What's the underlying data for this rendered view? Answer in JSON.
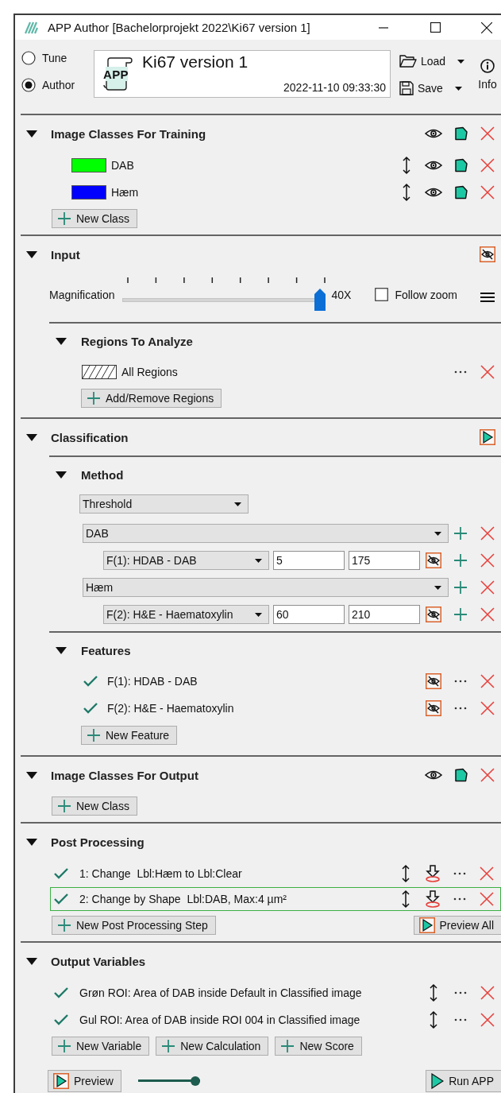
{
  "window": {
    "title": "APP Author [Bachelorprojekt 2022\\Ki67 version 1]"
  },
  "modes": [
    {
      "label": "Tune",
      "selected": false
    },
    {
      "label": "Author",
      "selected": true
    }
  ],
  "app": {
    "logo_text": "APP",
    "name": "Ki67 version 1",
    "timestamp": "2022-11-10 09:33:30"
  },
  "file_menu": [
    {
      "kind": "load",
      "label": "Load"
    },
    {
      "kind": "save",
      "label": "Save"
    }
  ],
  "info": {
    "label": "Info"
  },
  "sections": [
    {
      "kind": "classes",
      "title": "Image Classes For Training",
      "expanded": true,
      "classes": [
        {
          "name": "DAB",
          "color": "#00ff00"
        },
        {
          "name": "Hæm",
          "color": "#0000ff"
        }
      ],
      "buttons": [
        "New Class"
      ]
    },
    {
      "kind": "input",
      "title": "Input",
      "expanded": true,
      "magnification": {
        "label": "Magnification",
        "level": 1,
        "reading": "40X"
      },
      "follow_zoom": {
        "label": "Follow zoom",
        "checked": false
      },
      "subsections": [
        {
          "kind": "regions",
          "title": "Regions To Analyze",
          "expanded": true,
          "regions": [
            {
              "name": "All Regions"
            }
          ],
          "buttons": [
            "Add/Remove Regions"
          ]
        }
      ]
    },
    {
      "kind": "classification",
      "title": "Classification",
      "expanded": true,
      "subsections": [
        {
          "kind": "method",
          "title": "Method",
          "expanded": true,
          "method": "Threshold",
          "classes": [
            {
              "name": "DAB",
              "feature": "F(1): HDAB - DAB",
              "min": "5",
              "max": "175"
            },
            {
              "name": "Hæm",
              "feature": "F(2): H&E - Haematoxylin",
              "min": "60",
              "max": "210"
            }
          ]
        },
        {
          "kind": "features",
          "title": "Features",
          "expanded": true,
          "features": [
            {
              "name": "F(1): HDAB - DAB",
              "checked": true
            },
            {
              "name": "F(2): H&E - Haematoxylin",
              "checked": true
            }
          ],
          "buttons": [
            "New Feature"
          ]
        }
      ]
    },
    {
      "kind": "classes",
      "title": "Image Classes For Output",
      "expanded": true,
      "buttons": [
        "New Class"
      ]
    },
    {
      "kind": "steps",
      "title": "Post Processing",
      "expanded": true,
      "steps": [
        {
          "text": "1: Change  Lbl:Hæm to Lbl:Clear",
          "checked": true,
          "selected": false
        },
        {
          "text": "2: Change by Shape  Lbl:DAB, Max:4 µm²",
          "checked": true,
          "selected": true
        }
      ],
      "buttons": [
        "New Post Processing Step"
      ],
      "preview_button": "Preview All"
    },
    {
      "kind": "variables",
      "title": "Output Variables",
      "expanded": true,
      "variables": [
        {
          "text": "Grøn ROI: Area of DAB inside Default in Classified image",
          "checked": true
        },
        {
          "text": "Gul ROI: Area of DAB inside ROI 004 in Classified image",
          "checked": true
        }
      ],
      "buttons": [
        "New Variable",
        "New Calculation",
        "New Score"
      ]
    }
  ],
  "footer": {
    "preview_button": "Preview",
    "slider": {
      "level": 1
    },
    "run_button": "Run APP"
  }
}
